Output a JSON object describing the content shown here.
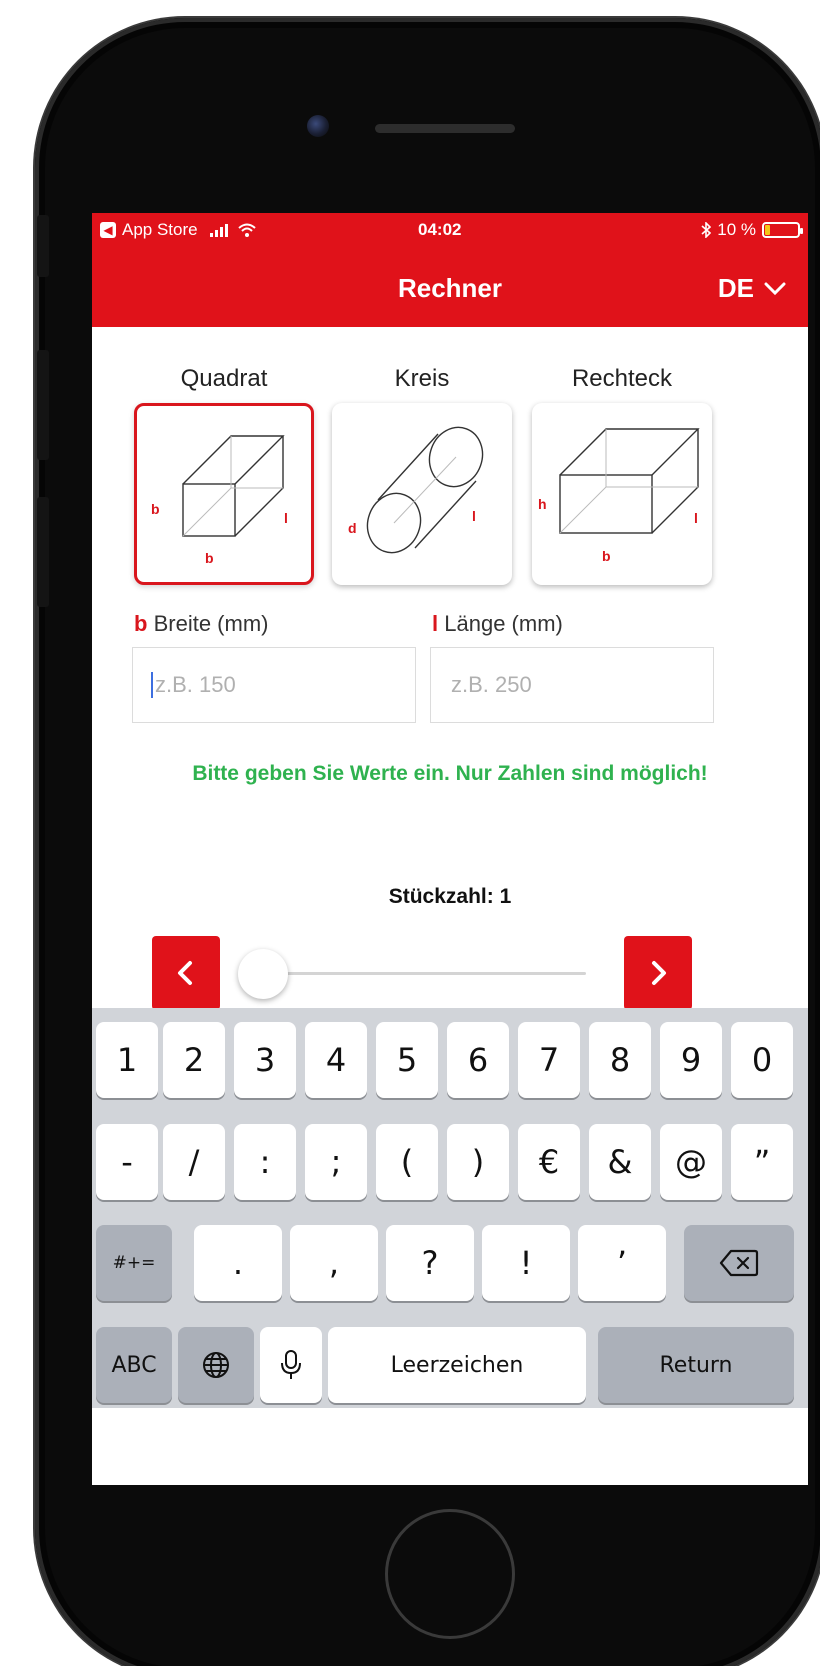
{
  "status_bar": {
    "back_app": "App Store",
    "time": "04:02",
    "battery": "10 %",
    "battery_level": 0.1
  },
  "nav": {
    "title": "Rechner",
    "language": "DE"
  },
  "shapes": [
    {
      "label": "Quadrat",
      "dims": [
        "b",
        "b",
        "l"
      ],
      "selected": true
    },
    {
      "label": "Kreis",
      "dims": [
        "d",
        "l"
      ],
      "selected": false
    },
    {
      "label": "Rechteck",
      "dims": [
        "h",
        "b",
        "l"
      ],
      "selected": false
    }
  ],
  "inputs": {
    "width": {
      "mark": "b",
      "label": "Breite (mm)",
      "placeholder": "z.B. 150"
    },
    "length": {
      "mark": "l",
      "label": "Länge (mm)",
      "placeholder": "z.B. 250"
    }
  },
  "hint": "Bitte geben Sie Werte ein. Nur Zahlen sind möglich!",
  "quantity": {
    "label": "Stückzahl: 1",
    "value": 1
  },
  "keyboard": {
    "row1": [
      "1",
      "2",
      "3",
      "4",
      "5",
      "6",
      "7",
      "8",
      "9",
      "0"
    ],
    "row2": [
      "-",
      "/",
      ":",
      ";",
      "(",
      ")",
      "€",
      "&",
      "@",
      "”"
    ],
    "row3_toggle": "#+=",
    "row3": [
      ".",
      ",",
      "?",
      "!",
      "’"
    ],
    "abc": "ABC",
    "space": "Leerzeichen",
    "return": "Return"
  },
  "colors": {
    "brand_red": "#e0121a",
    "hint_green": "#2fb24f",
    "keyboard_bg": "#d1d4d9"
  }
}
